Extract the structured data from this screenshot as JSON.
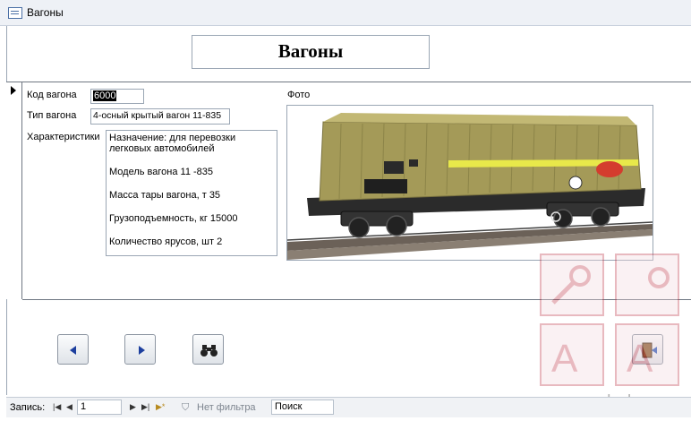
{
  "window": {
    "title": "Вагоны",
    "icon": "form-icon"
  },
  "form": {
    "heading": "Вагоны",
    "labels": {
      "code": "Код вагона",
      "type": "Тип вагона",
      "specs": "Характеристики",
      "photo": "Фото"
    },
    "values": {
      "code": "6000",
      "type": "4-осный крытый вагон 11-835",
      "specs_lines": [
        "Назначение: для перевозки",
        "легковых автомобилей",
        "Модель вагона 11 -835",
        "Масса тары вагона, т 35",
        "Грузоподъемность, кг 15000",
        "Количество ярусов, шт 2"
      ]
    },
    "photo_image": "railway-covered-wagon-image",
    "photo_colors": {
      "body": "#a49a58",
      "stripe": "#e8e84a",
      "logo": "#d43c2e"
    }
  },
  "buttons": {
    "prev": "triangle-left-icon",
    "next": "triangle-right-icon",
    "find": "binoculars-icon",
    "exit": "exit-door-icon"
  },
  "status_bar": {
    "record_label": "Запись:",
    "record_number": "1",
    "filter_label": "Нет фильтра",
    "search_label": "Поиск"
  },
  "watermark": {
    "text": "accesshelp.ru",
    "accent": "#c0394b"
  }
}
